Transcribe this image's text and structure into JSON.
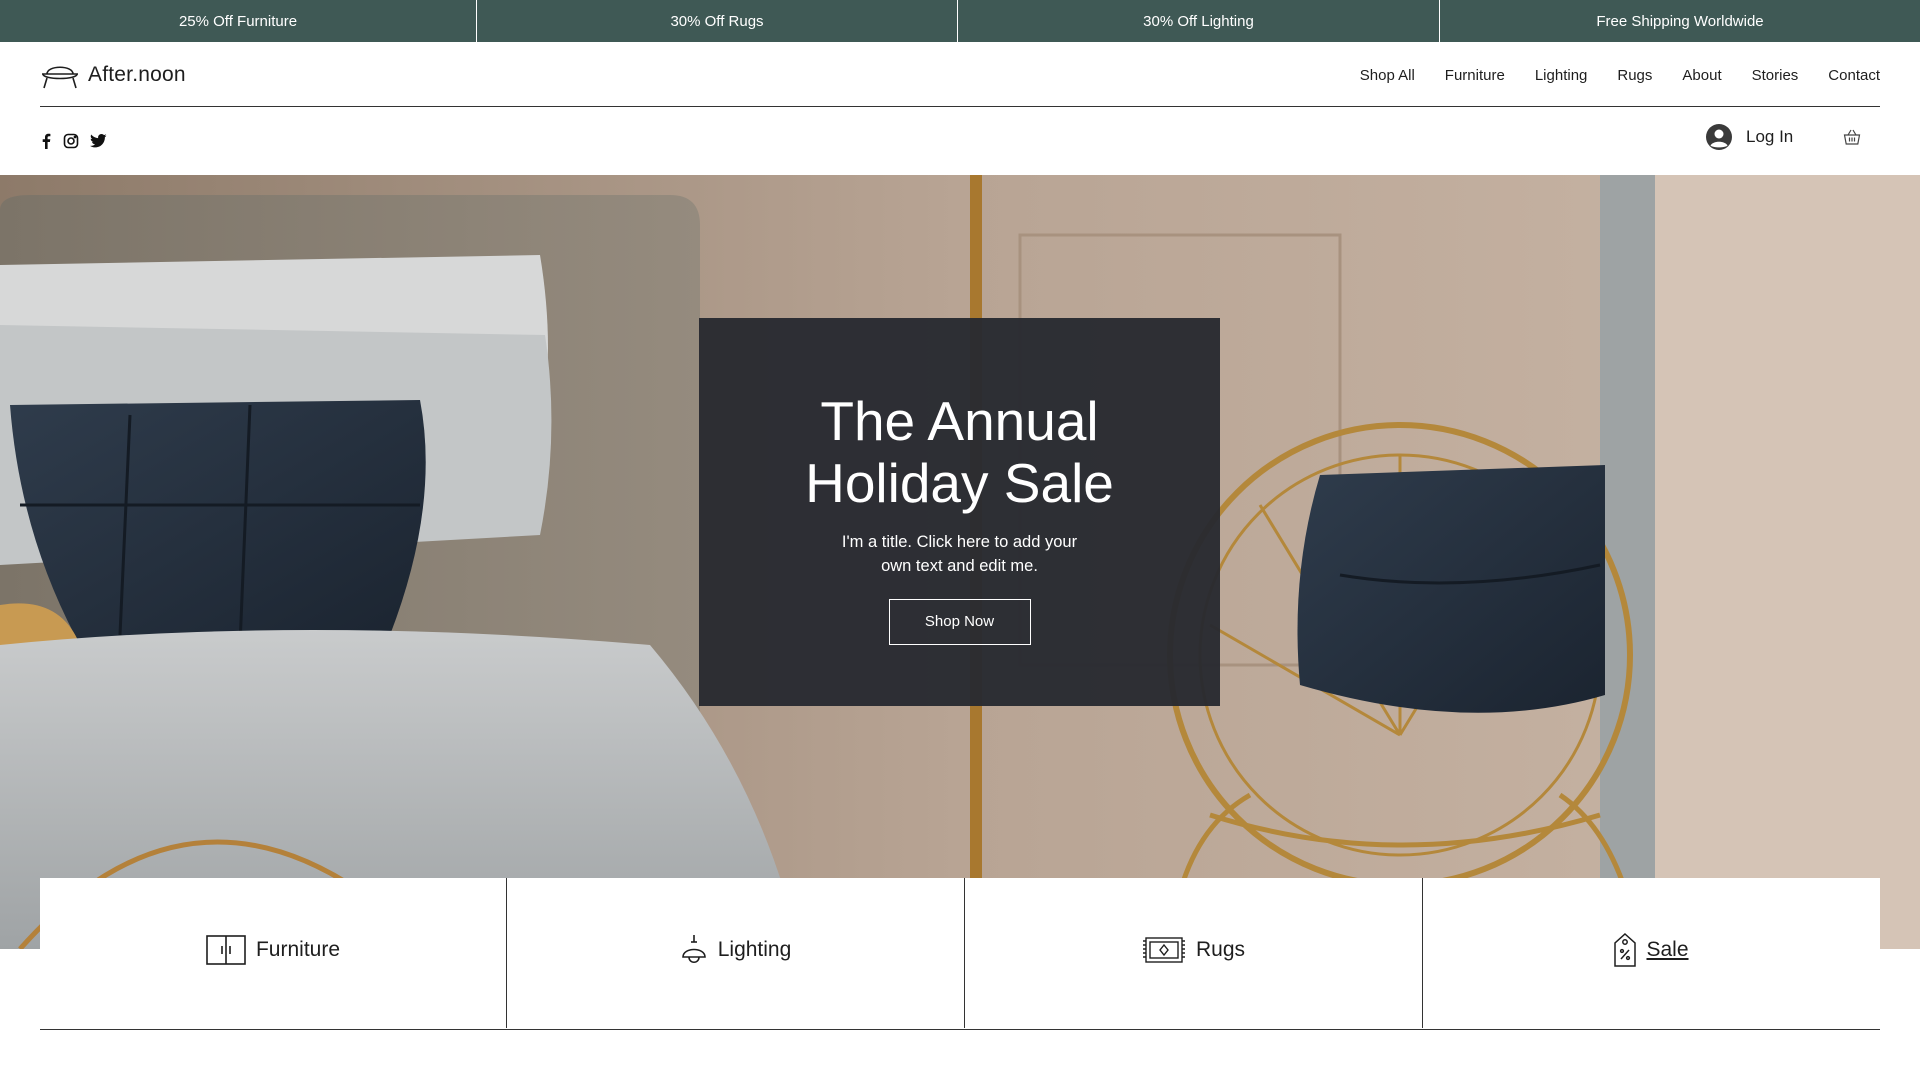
{
  "promo_bar": {
    "items": [
      "25% Off Furniture",
      "30% Off Rugs",
      "30% Off Lighting",
      "Free Shipping Worldwide"
    ],
    "background": "#3f5955"
  },
  "header": {
    "logo_text": "After.noon",
    "logo_icon": "chair-icon",
    "nav": [
      "Shop All",
      "Furniture",
      "Lighting",
      "Rugs",
      "About",
      "Stories",
      "Contact"
    ]
  },
  "subheader": {
    "social_icons": [
      "facebook-icon",
      "instagram-icon",
      "twitter-icon"
    ],
    "login_label": "Log In",
    "cart_icon": "basket-icon"
  },
  "hero": {
    "title_line1": "The Annual",
    "title_line2": "Holiday Sale",
    "subtitle": "I'm a title. Click here to add your own text and edit me.",
    "button_label": "Shop Now"
  },
  "categories": [
    {
      "label": "Furniture",
      "icon": "cabinet-icon"
    },
    {
      "label": "Lighting",
      "icon": "pendant-lamp-icon"
    },
    {
      "label": "Rugs",
      "icon": "rug-icon"
    },
    {
      "label": "Sale",
      "icon": "sale-tag-icon"
    }
  ]
}
